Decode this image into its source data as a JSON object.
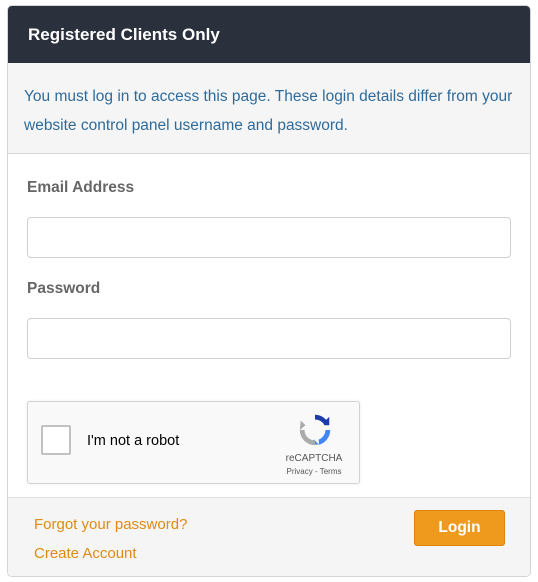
{
  "header": {
    "title": "Registered Clients Only"
  },
  "notice": {
    "text": "You must log in to access this page. These login details differ from your website control panel username and password."
  },
  "form": {
    "email_label": "Email Address",
    "email_value": "",
    "password_label": "Password",
    "password_value": ""
  },
  "captcha": {
    "checkbox_label": "I'm not a robot",
    "brand": "reCAPTCHA",
    "links": "Privacy - Terms",
    "logo_icon": "recaptcha-logo-icon"
  },
  "footer": {
    "forgot_label": "Forgot your password?",
    "create_label": "Create Account",
    "login_label": "Login"
  },
  "colors": {
    "header_bg": "#2b313c",
    "notice_text": "#2f6b9a",
    "link": "#e08a12",
    "login_button": "#ef9a1c"
  }
}
